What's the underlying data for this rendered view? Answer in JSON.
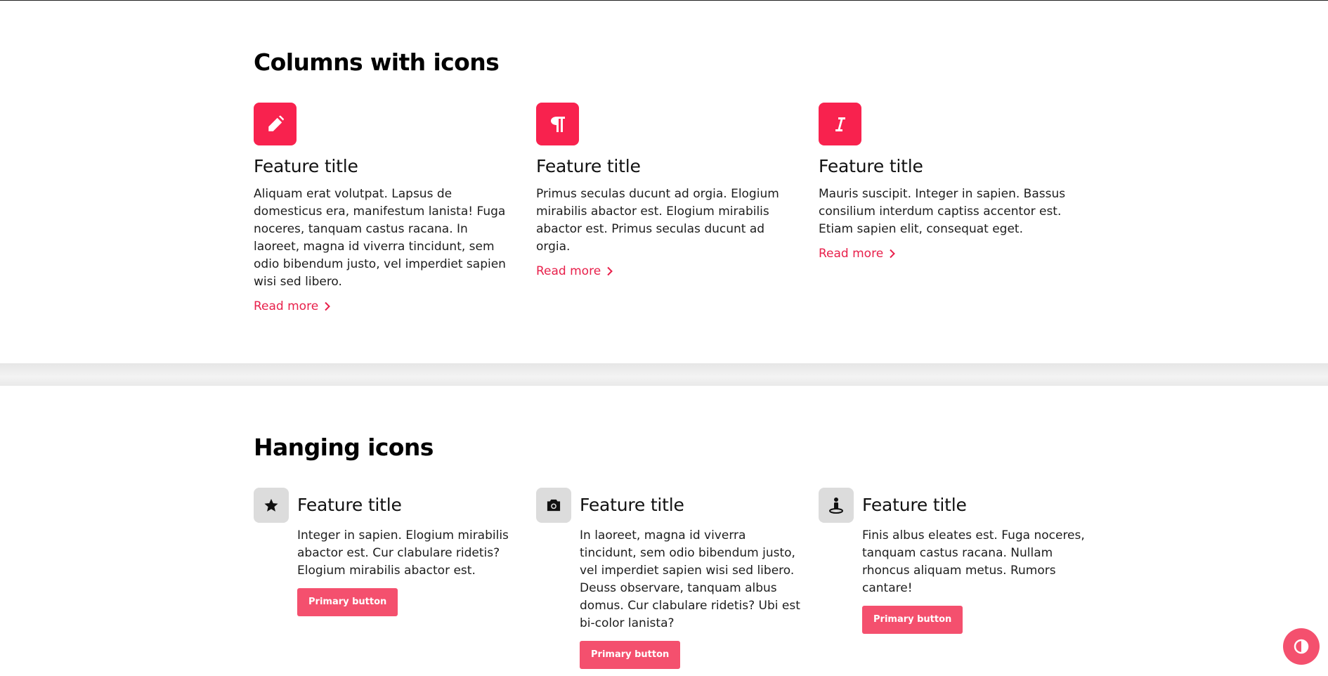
{
  "section_columns": {
    "heading": "Columns with icons",
    "features": [
      {
        "icon": "pencil-icon",
        "title": "Feature title",
        "text": "Aliquam erat volutpat. Lapsus de domesticus era, manifestum lanista! Fuga noceres, tanquam castus racana. In laoreet, magna id viverra tincidunt, sem odio bibendum justo, vel imperdiet sapien wisi sed libero.",
        "link": "Read more"
      },
      {
        "icon": "paragraph-icon",
        "title": "Feature title",
        "text": "Primus seculas ducunt ad orgia. Elogium mirabilis abactor est. Elogium mirabilis abactor est. Primus seculas ducunt ad orgia.",
        "link": "Read more"
      },
      {
        "icon": "italic-icon",
        "title": "Feature title",
        "text": "Mauris suscipit. Integer in sapien. Bassus consilium interdum captiss accentor est. Etiam sapien elit, consequat eget.",
        "link": "Read more"
      }
    ]
  },
  "section_hanging": {
    "heading": "Hanging icons",
    "features": [
      {
        "icon": "star-icon",
        "title": "Feature title",
        "text": "Integer in sapien. Elogium mirabilis abactor est. Cur clabulare ridetis? Elogium mirabilis abactor est.",
        "button": "Primary button"
      },
      {
        "icon": "camera-icon",
        "title": "Feature title",
        "text": "In laoreet, magna id viverra tincidunt, sem odio bibendum justo, vel imperdiet sapien wisi sed libero. Deuss observare, tanquam albus domus. Cur clabulare ridetis? Ubi est bi-color lanista?",
        "button": "Primary button"
      },
      {
        "icon": "person-pin-icon",
        "title": "Feature title",
        "text": "Finis albus eleates est. Fuga noceres, tanquam castus racana. Nullam rhoncus aliquam metus. Rumors cantare!",
        "button": "Primary button"
      }
    ]
  },
  "theme_toggle": {
    "icon": "contrast-icon"
  },
  "colors": {
    "accent": "#f8224e",
    "button": "#f4506e",
    "link": "#e8204b",
    "icon_tile_muted": "#dcdcdc"
  }
}
